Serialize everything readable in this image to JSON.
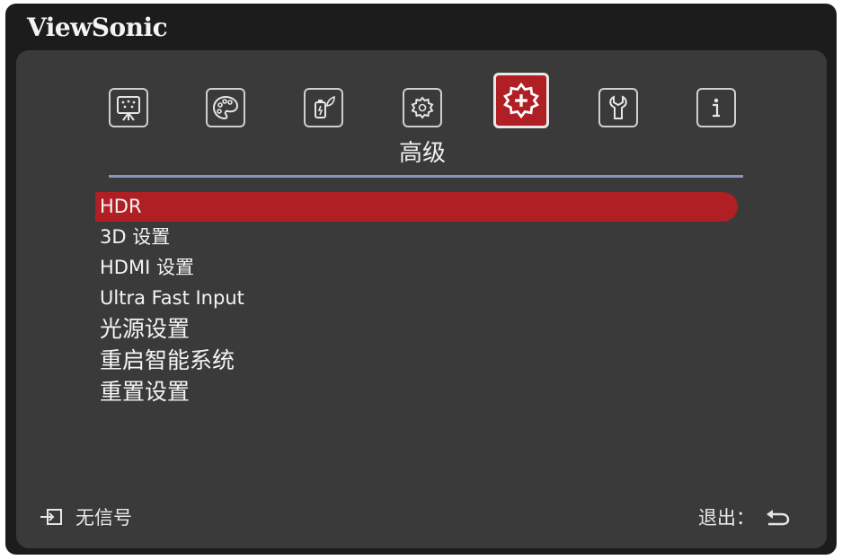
{
  "brand": "ViewSonic",
  "tabs": [
    {
      "icon": "display-icon"
    },
    {
      "icon": "palette-icon"
    },
    {
      "icon": "power-saving-icon"
    },
    {
      "icon": "basic-gear-icon"
    },
    {
      "icon": "advanced-gear-icon",
      "active": true
    },
    {
      "icon": "wrench-icon"
    },
    {
      "icon": "info-icon"
    }
  ],
  "active_tab_title": "高级",
  "menu": [
    {
      "label": "HDR",
      "selected": true
    },
    {
      "label": "3D 设置"
    },
    {
      "label": "HDMI 设置"
    },
    {
      "label": "Ultra Fast Input"
    },
    {
      "label": "光源设置"
    },
    {
      "label": "重启智能系统"
    },
    {
      "label": "重置设置"
    }
  ],
  "footer": {
    "source_status": "无信号",
    "exit_label": "退出："
  },
  "colors": {
    "accent": "#b01f24",
    "panel": "#3a3a3a",
    "frame": "#1c1c1c",
    "divider": "#8a93b8"
  }
}
